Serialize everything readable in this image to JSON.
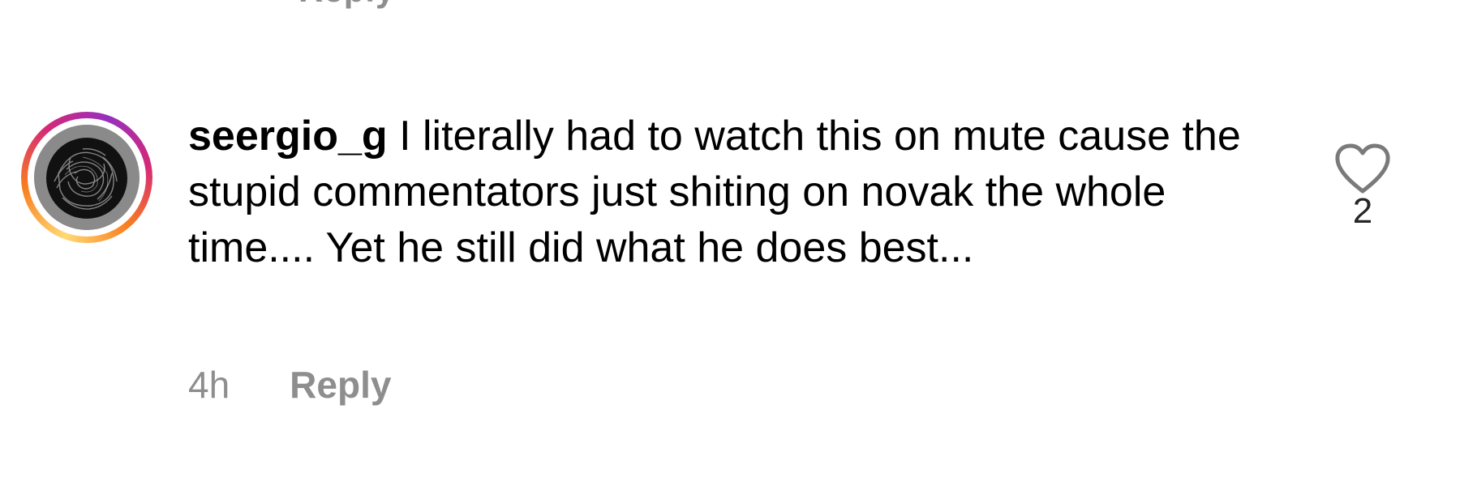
{
  "previous_comment": {
    "reply_label_partial": "Reply"
  },
  "comment": {
    "username": "seergio_g",
    "text": "I literally had to watch this on mute cause the stupid commentators just shiting on novak the whole time.... Yet he still did what he does best...",
    "time": "4h",
    "reply_label": "Reply",
    "like_count": "2",
    "like_icon": "heart-outline-icon",
    "avatar_icon": "avatar-image"
  },
  "colors": {
    "text": "#000000",
    "meta": "#8e8e8e",
    "story_ring": [
      "#feda75",
      "#fa7e1e",
      "#d62976",
      "#962fbf"
    ]
  }
}
